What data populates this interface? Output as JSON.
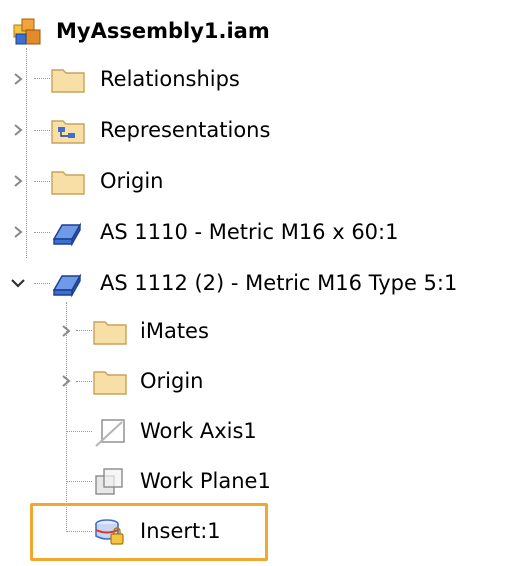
{
  "tree": {
    "root": {
      "label": "MyAssembly1.iam",
      "icon": "assembly-icon"
    },
    "children": [
      {
        "label": "Relationships",
        "icon": "folder-icon",
        "expanded": false
      },
      {
        "label": "Representations",
        "icon": "representations-icon",
        "expanded": false
      },
      {
        "label": "Origin",
        "icon": "folder-icon",
        "expanded": false
      },
      {
        "label": "AS 1110 - Metric M16 x 60:1",
        "icon": "part-icon",
        "expanded": false
      },
      {
        "label": "AS 1112 (2) - Metric M16  Type 5:1",
        "icon": "part-icon",
        "expanded": true,
        "children": [
          {
            "label": "iMates",
            "icon": "folder-icon",
            "expanded": false
          },
          {
            "label": "Origin",
            "icon": "folder-icon",
            "expanded": false
          },
          {
            "label": "Work Axis1",
            "icon": "work-axis-icon"
          },
          {
            "label": "Work Plane1",
            "icon": "work-plane-icon"
          },
          {
            "label": "Insert:1",
            "icon": "insert-constraint-icon",
            "highlighted": true
          }
        ]
      }
    ]
  },
  "colors": {
    "highlight_border": "#f0a830",
    "folder_fill": "#f7dfa5",
    "folder_stroke": "#c9a25a",
    "part_blue": "#3b6fd4"
  }
}
